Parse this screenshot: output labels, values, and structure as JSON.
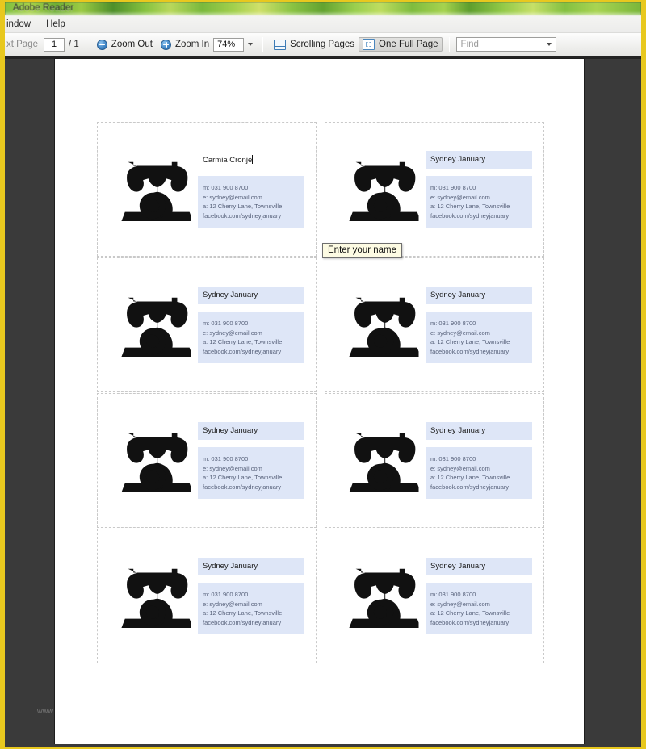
{
  "window": {
    "title": "Adobe Reader"
  },
  "menubar": {
    "items": [
      {
        "label": "indow",
        "name": "menu-window"
      },
      {
        "label": "Help",
        "name": "menu-help"
      }
    ]
  },
  "toolbar": {
    "next_page_label": "xt Page",
    "page_number": "1",
    "page_total": "/ 1",
    "zoom_out_label": "Zoom Out",
    "zoom_in_label": "Zoom In",
    "zoom_level": "74%",
    "scrolling_pages_label": "Scrolling Pages",
    "one_full_page_label": "One Full Page",
    "find_placeholder": "Find",
    "icons": {
      "zoom_out": "minus-circle-icon",
      "zoom_in": "plus-circle-icon",
      "scrolling_pages": "scrolling-pages-icon",
      "one_full_page": "one-full-page-icon",
      "zoom_dropdown": "chevron-down-icon",
      "find_dropdown": "chevron-down-icon"
    }
  },
  "tooltip": {
    "text": "Enter your name"
  },
  "watermark": {
    "text": "www.hloom.com"
  },
  "card_template": {
    "icon_name": "rotary-telephone-icon",
    "details": {
      "mobile": "m: 031 900 8700",
      "email": "e: sydney@email.com",
      "address": "a: 12 Cherry Lane, Townsville",
      "facebook": "facebook.com/sydneyjanuary"
    }
  },
  "cards": [
    {
      "name": "Carmia Cronjé",
      "focused": true
    },
    {
      "name": "Sydney January",
      "focused": false
    },
    {
      "name": "Sydney January",
      "focused": false
    },
    {
      "name": "Sydney January",
      "focused": false
    },
    {
      "name": "Sydney January",
      "focused": false
    },
    {
      "name": "Sydney January",
      "focused": false
    },
    {
      "name": "Sydney January",
      "focused": false
    },
    {
      "name": "Sydney January",
      "focused": false
    }
  ],
  "colors": {
    "window_border": "#e8c81e",
    "title_bar_green": "#7fbf3f",
    "doc_background": "#3a3a3a",
    "page_white": "#ffffff",
    "field_blue": "#dee6f7",
    "tooltip_yellow": "#fdfbe3",
    "icon_black": "#111111"
  }
}
